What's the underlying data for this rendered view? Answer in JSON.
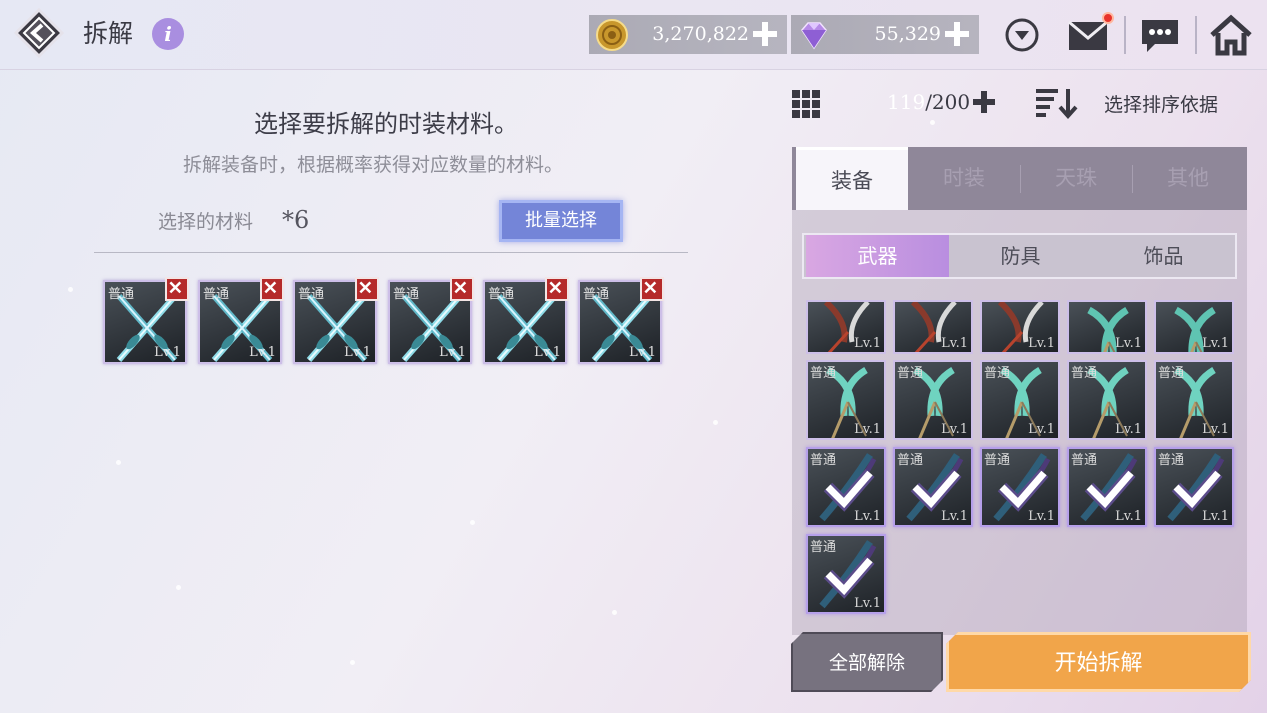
{
  "header": {
    "title": "拆解",
    "info_icon": "i",
    "gold": "3,270,822",
    "diamond": "55,329",
    "mail_has_notification": true
  },
  "left": {
    "heading": "选择要拆解的时装材料。",
    "subheading": "拆解装备时，根据概率获得对应数量的材料。",
    "selected_label": "选择的材料",
    "selected_count": "*6",
    "batch_select": "批量选择",
    "slots": [
      {
        "rarity": "普通",
        "level": "Lv.1"
      },
      {
        "rarity": "普通",
        "level": "Lv.1"
      },
      {
        "rarity": "普通",
        "level": "Lv.1"
      },
      {
        "rarity": "普通",
        "level": "Lv.1"
      },
      {
        "rarity": "普通",
        "level": "Lv.1"
      },
      {
        "rarity": "普通",
        "level": "Lv.1"
      }
    ]
  },
  "right": {
    "bag_current": "119",
    "bag_max": "/200",
    "sort_label": "选择排序依据",
    "tabs": [
      "装备",
      "时装",
      "天珠",
      "其他"
    ],
    "subtabs": [
      "武器",
      "防具",
      "饰品"
    ],
    "items_row1": [
      {
        "level": "Lv.1"
      },
      {
        "level": "Lv.1"
      },
      {
        "level": "Lv.1"
      },
      {
        "level": "Lv.1"
      },
      {
        "level": "Lv.1"
      }
    ],
    "items_row2": [
      {
        "rarity": "普通",
        "level": "Lv.1"
      },
      {
        "rarity": "普通",
        "level": "Lv.1"
      },
      {
        "rarity": "普通",
        "level": "Lv.1"
      },
      {
        "rarity": "普通",
        "level": "Lv.1"
      },
      {
        "rarity": "普通",
        "level": "Lv.1"
      }
    ],
    "items_row3": [
      {
        "rarity": "普通",
        "level": "Lv.1"
      },
      {
        "rarity": "普通",
        "level": "Lv.1"
      },
      {
        "rarity": "普通",
        "level": "Lv.1"
      },
      {
        "rarity": "普通",
        "level": "Lv.1"
      },
      {
        "rarity": "普通",
        "level": "Lv.1"
      }
    ],
    "items_row4": [
      {
        "rarity": "普通",
        "level": "Lv.1"
      }
    ],
    "clear_all": "全部解除",
    "start": "开始拆解"
  },
  "colors": {
    "accent_purple": "#b98ee0",
    "batch_blue": "#7485d8",
    "start_orange": "#f1a54a",
    "remove_red": "#b52a2a"
  },
  "icons": [
    "back-icon",
    "info-icon",
    "gold-coin-icon",
    "diamond-icon",
    "plus-icon",
    "dropdown-icon",
    "mail-icon",
    "chat-icon",
    "home-icon",
    "grid-icon",
    "sort-icon",
    "close-icon",
    "checkmark-icon"
  ]
}
